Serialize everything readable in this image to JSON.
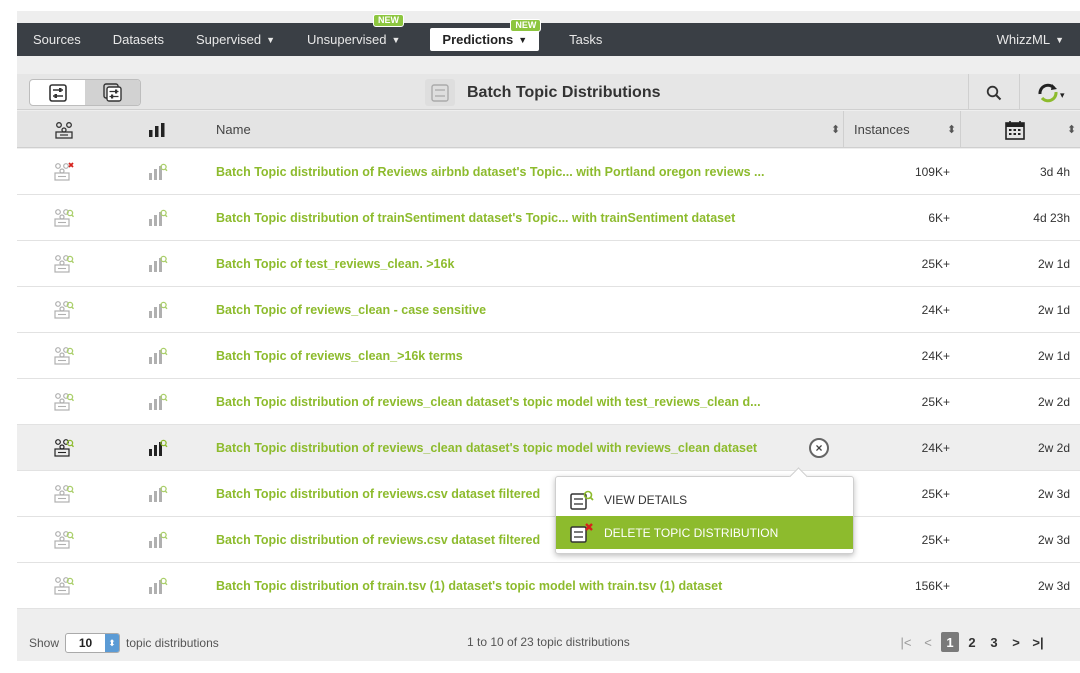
{
  "nav": {
    "items": [
      {
        "label": "Sources",
        "caret": false,
        "badge": ""
      },
      {
        "label": "Datasets",
        "caret": false,
        "badge": ""
      },
      {
        "label": "Supervised",
        "caret": true,
        "badge": ""
      },
      {
        "label": "Unsupervised",
        "caret": true,
        "badge": "NEW"
      },
      {
        "label": "Predictions",
        "caret": true,
        "badge": "NEW",
        "active": true
      },
      {
        "label": "Tasks",
        "caret": false,
        "badge": ""
      }
    ],
    "right": "WhizzML"
  },
  "header": {
    "title": "Batch Topic Distributions"
  },
  "table": {
    "columns": {
      "name": "Name",
      "instances": "Instances"
    },
    "rows": [
      {
        "name": "Batch Topic distribution of Reviews airbnb dataset's Topic... with Portland oregon reviews ...",
        "instances": "109K+",
        "age": "3d 4h",
        "status": "error"
      },
      {
        "name": "Batch Topic distribution of trainSentiment dataset's Topic... with trainSentiment dataset",
        "instances": "6K+",
        "age": "4d 23h",
        "status": "ok"
      },
      {
        "name": "Batch Topic of test_reviews_clean. >16k",
        "instances": "25K+",
        "age": "2w 1d",
        "status": "ok"
      },
      {
        "name": "Batch Topic of reviews_clean - case sensitive",
        "instances": "24K+",
        "age": "2w 1d",
        "status": "ok"
      },
      {
        "name": "Batch Topic of reviews_clean_>16k terms",
        "instances": "24K+",
        "age": "2w 1d",
        "status": "ok"
      },
      {
        "name": "Batch Topic distribution of reviews_clean dataset's topic model with test_reviews_clean d...",
        "instances": "25K+",
        "age": "2w 2d",
        "status": "ok"
      },
      {
        "name": "Batch Topic distribution of reviews_clean dataset's topic model with reviews_clean dataset",
        "instances": "24K+",
        "age": "2w 2d",
        "status": "hover"
      },
      {
        "name": "Batch Topic distribution of reviews.csv dataset filtered",
        "instances": "25K+",
        "age": "2w 3d",
        "status": "ok"
      },
      {
        "name": "Batch Topic distribution of reviews.csv dataset filtered",
        "instances": "25K+",
        "age": "2w 3d",
        "status": "ok"
      },
      {
        "name": "Batch Topic distribution of train.tsv (1) dataset's topic model with train.tsv (1) dataset",
        "instances": "156K+",
        "age": "2w 3d",
        "status": "ok"
      }
    ]
  },
  "context_menu": {
    "view_details": "VIEW DETAILS",
    "delete": "DELETE TOPIC DISTRIBUTION"
  },
  "footer": {
    "show_label": "Show",
    "page_size": "10",
    "suffix": "topic distributions",
    "range": "1 to 10 of 23 topic distributions",
    "pages": [
      "1",
      "2",
      "3"
    ],
    "current_page": "1"
  },
  "colors": {
    "accent": "#8dbb2d",
    "nav_bg": "#3a3f45",
    "badge": "#8dc63f"
  }
}
